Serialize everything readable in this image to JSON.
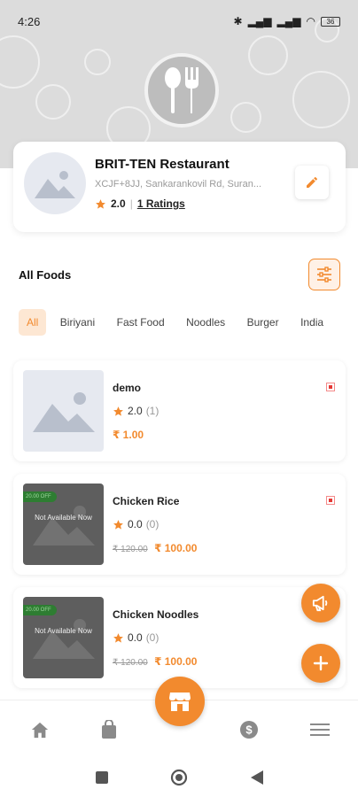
{
  "status_bar": {
    "time": "4:26",
    "battery": "36"
  },
  "restaurant": {
    "name": "BRIT-TEN Restaurant",
    "address": "XCJF+8JJ, Sankarankovil Rd, Suran...",
    "rating": "2.0",
    "ratings_count": "1 Ratings"
  },
  "foods_section": {
    "title": "All Foods"
  },
  "categories": [
    "All",
    "Biriyani",
    "Fast Food",
    "Noodles",
    "Burger",
    "India"
  ],
  "foods": [
    {
      "name": "demo",
      "rating": "2.0",
      "rating_count": "(1)",
      "old_price": "",
      "price": "₹ 1.00",
      "discount": "",
      "availability": ""
    },
    {
      "name": "Chicken Rice",
      "rating": "0.0",
      "rating_count": "(0)",
      "old_price": "₹ 120.00",
      "price": "₹ 100.00",
      "discount": "20.00 OFF",
      "availability": "Not Available Now"
    },
    {
      "name": "Chicken Noodles",
      "rating": "0.0",
      "rating_count": "(0)",
      "old_price": "₹ 120.00",
      "price": "₹ 100.00",
      "discount": "20.00 OFF",
      "availability": "Not Available Now"
    }
  ],
  "icons": {
    "logo": "spoon-fork-icon",
    "edit": "pencil-icon",
    "filter": "sliders-icon",
    "promo": "megaphone-icon",
    "add": "plus-icon",
    "nav": [
      "home-icon",
      "bag-icon",
      "store-icon",
      "dollar-icon",
      "menu-icon"
    ]
  },
  "colors": {
    "accent": "#F28A2E",
    "header_bg": "#DCDCDC",
    "veg_mark": "#E53935",
    "discount_badge": "#2E7D32"
  }
}
